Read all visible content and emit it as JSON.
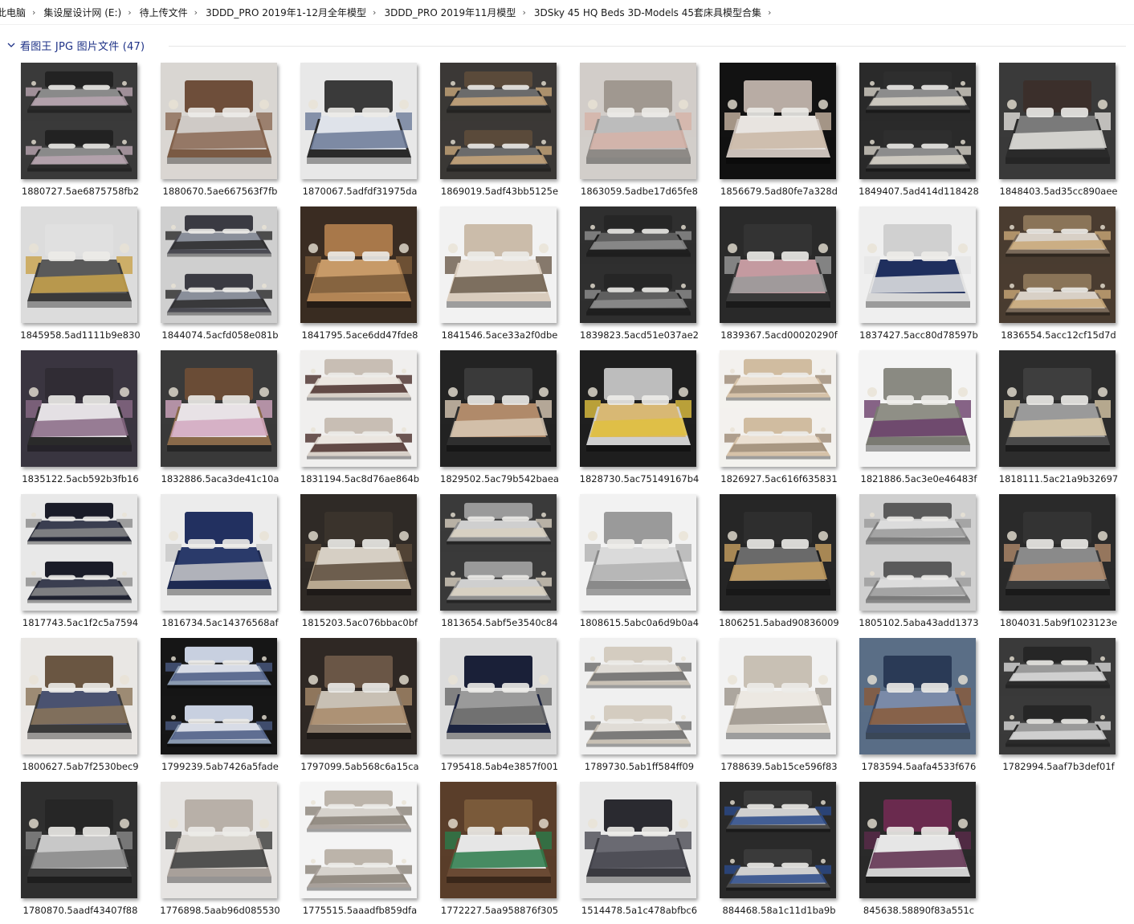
{
  "breadcrumb": [
    "此电脑",
    "集设屋设计网 (E:)",
    "待上传文件",
    "3DDD_PRO 2019年1-12月全年模型",
    "3DDD_PRO 2019年11月模型",
    "3DSky 45 HQ Beds 3D-Models 45套床具模型合集"
  ],
  "group": {
    "title": "看图王 JPG 图片文件 (47)"
  },
  "files": [
    {
      "name": "1880727.5ae6875758fb2",
      "bg": "#3a3a3a",
      "bed": "#2b2b2b",
      "linen": "#8a8a8a",
      "accent": "#b9a5b0",
      "head": "#222222"
    },
    {
      "name": "1880670.5ae667563f7fb",
      "bg": "#d9d6d2",
      "bed": "#7a5a44",
      "linen": "#cfcac6",
      "accent": "#8b6a55",
      "head": "#6e4e3a"
    },
    {
      "name": "1870067.5adfdf31975da",
      "bg": "#e8e8e8",
      "bed": "#2a2a2a",
      "linen": "#dfe3ea",
      "accent": "#6c7a98",
      "head": "#3a3a3a"
    },
    {
      "name": "1869019.5adf43bb5125e",
      "bg": "#3b3836",
      "bed": "#2a2a2a",
      "linen": "#6b6b6b",
      "accent": "#c8a67a",
      "head": "#5a4a3a"
    },
    {
      "name": "1863059.5adbe17d65fe8",
      "bg": "#d2cdc9",
      "bed": "#8e8a86",
      "linen": "#bcbcbc",
      "accent": "#d6b3a8",
      "head": "#a09890"
    },
    {
      "name": "1856679.5ad80fe7a328d",
      "bg": "#121212",
      "bed": "#c9bfb8",
      "linen": "#e8e4e0",
      "accent": "#c9b7a4",
      "head": "#b8aca4"
    },
    {
      "name": "1849407.5ad414d118428",
      "bg": "#2a2a2a",
      "bed": "#3a3a3a",
      "linen": "#8c8c8c",
      "accent": "#d7d2c8",
      "head": "#2e2e2e"
    },
    {
      "name": "1848403.5ad35cc890aee",
      "bg": "#3a3a3a",
      "bed": "#2a2a2a",
      "linen": "#7a7a7a",
      "accent": "#e2e0dc",
      "head": "#3b2f2b"
    },
    {
      "name": "1845958.5ad1111b9e830",
      "bg": "#dcdcdc",
      "bed": "#3a3a3a",
      "linen": "#5a5a5a",
      "accent": "#c9a34b",
      "head": "#e0e0e0"
    },
    {
      "name": "1844074.5acfd058e081b",
      "bg": "#cfcfcf",
      "bed": "#4a4a52",
      "linen": "#8a8f9a",
      "accent": "#2a2a2a",
      "head": "#3a3a42"
    },
    {
      "name": "1841795.5ace6dd47fde8",
      "bg": "#3a2c22",
      "bed": "#b38555",
      "linen": "#c79a68",
      "accent": "#7a5a3a",
      "head": "#a8784a"
    },
    {
      "name": "1841546.5ace33a2f0dbe",
      "bg": "#f2f2f2",
      "bed": "#d9ccbd",
      "linen": "#e8e0d6",
      "accent": "#6a5a4a",
      "head": "#cbbcaa"
    },
    {
      "name": "1839823.5acd51e037ae2",
      "bg": "#2f2f2f",
      "bed": "#1f1f1f",
      "linen": "#5f5f5f",
      "accent": "#8e8e8e",
      "head": "#262626"
    },
    {
      "name": "1839367.5acd00020290f",
      "bg": "#2a2a2a",
      "bed": "#3a3a3a",
      "linen": "#c49aa0",
      "accent": "#9a9a9a",
      "head": "#333333"
    },
    {
      "name": "1837427.5acc80d78597b",
      "bg": "#efefef",
      "bed": "#d8d8d8",
      "linen": "#1f2f5e",
      "accent": "#e6e6e6",
      "head": "#d0d0d0"
    },
    {
      "name": "1836554.5acc12cf15d7d",
      "bg": "#4a3c30",
      "bed": "#7a6a5a",
      "linen": "#d8d0c6",
      "accent": "#c9a878",
      "head": "#8a7458"
    },
    {
      "name": "1835122.5acb592b3fb16",
      "bg": "#3a3540",
      "bed": "#2a2a2a",
      "linen": "#e4e0e4",
      "accent": "#8a6a86",
      "head": "#302c34"
    },
    {
      "name": "1832886.5aca3de41c10a",
      "bg": "#3a3a3a",
      "bed": "#8a6a4a",
      "linen": "#e8e2e6",
      "accent": "#d2a8c0",
      "head": "#6a4c36"
    },
    {
      "name": "1831194.5ac8d76ae864b",
      "bg": "#f0efee",
      "bed": "#d8d0c8",
      "linen": "#ebe6e0",
      "accent": "#4a2e2a",
      "head": "#c8beb4"
    },
    {
      "name": "1829502.5ac79b542baea",
      "bg": "#232323",
      "bed": "#2f2f2f",
      "linen": "#b08a6a",
      "accent": "#d8c8b4",
      "head": "#3a3a3a"
    },
    {
      "name": "1828730.5ac75149167b4",
      "bg": "#1f1f1f",
      "bed": "#cfcfcf",
      "linen": "#d8b874",
      "accent": "#e0c040",
      "head": "#bdbdbd"
    },
    {
      "name": "1826927.5ac616f635831",
      "bg": "#f3f1ee",
      "bed": "#d6c2a8",
      "linen": "#ebe0d2",
      "accent": "#9c8a74",
      "head": "#d0bca0"
    },
    {
      "name": "1821886.5ac3e0e46483f",
      "bg": "#f4f4f4",
      "bed": "#7a7a72",
      "linen": "#8f8f86",
      "accent": "#6a3e6a",
      "head": "#8a8a82"
    },
    {
      "name": "1818111.5ac21a9b32697",
      "bg": "#2c2c2c",
      "bed": "#4a4a4a",
      "linen": "#9a9a9a",
      "accent": "#d8c8a8",
      "head": "#3e3e3e"
    },
    {
      "name": "1817743.5ac1f2c5a7594",
      "bg": "#e8e8e8",
      "bed": "#1f2230",
      "linen": "#3a3e50",
      "accent": "#8a8a8a",
      "head": "#1a1c28"
    },
    {
      "name": "1816734.5ac14376568af",
      "bg": "#ececec",
      "bed": "#1e2a52",
      "linen": "#2a3a6a",
      "accent": "#c8c8c8",
      "head": "#223060"
    },
    {
      "name": "1815203.5ac076bbac0bf",
      "bg": "#2f2a26",
      "bed": "#b8a890",
      "linen": "#d6cfc4",
      "accent": "#5a4a3a",
      "head": "#3a332c"
    },
    {
      "name": "1813654.5abf5e3540c84",
      "bg": "#3a3a3a",
      "bed": "#8e8e8e",
      "linen": "#cfcfcf",
      "accent": "#d8d0c0",
      "head": "#9a9a9a"
    },
    {
      "name": "1808615.5abc0a6d9b0a4",
      "bg": "#f2f2f2",
      "bed": "#8a8a8a",
      "linen": "#dadada",
      "accent": "#b0b0b0",
      "head": "#9a9a9a"
    },
    {
      "name": "1806251.5abad90836009",
      "bg": "#262626",
      "bed": "#1f1f1f",
      "linen": "#6a6a6a",
      "accent": "#c8a060",
      "head": "#2e2e2e"
    },
    {
      "name": "1805102.5aba43add1373",
      "bg": "#cfcfcf",
      "bed": "#7a7a7a",
      "linen": "#dcdcdc",
      "accent": "#9a9a9a",
      "head": "#5a5a5a"
    },
    {
      "name": "1804031.5ab9f1023123e",
      "bg": "#2a2a2a",
      "bed": "#3a3a3a",
      "linen": "#8a8a8a",
      "accent": "#b08a6a",
      "head": "#333333"
    },
    {
      "name": "1800627.5ab7f2530bec9",
      "bg": "#e9e7e4",
      "bed": "#3a3a3a",
      "linen": "#4a5270",
      "accent": "#8a7458",
      "head": "#6a5642"
    },
    {
      "name": "1799239.5ab7426a5fade",
      "bg": "#161616",
      "bed": "#8a9ab0",
      "linen": "#d8dce6",
      "accent": "#4a5a82",
      "head": "#c8d0e0"
    },
    {
      "name": "1797099.5ab568c6a15ca",
      "bg": "#2f2824",
      "bed": "#8a7a6a",
      "linen": "#c8c0b4",
      "accent": "#a88a6a",
      "head": "#6a5646"
    },
    {
      "name": "1795418.5ab4e3857f001",
      "bg": "#dcdcdc",
      "bed": "#1c2440",
      "linen": "#9a9a9a",
      "accent": "#6a6a6a",
      "head": "#1a2038"
    },
    {
      "name": "1789730.5ab1ff584ff09",
      "bg": "#f0f0f0",
      "bed": "#c8c0b4",
      "linen": "#e0dcd6",
      "accent": "#6a6a6a",
      "head": "#d4ccc0"
    },
    {
      "name": "1788639.5ab15ce596f83",
      "bg": "#f2f2f2",
      "bed": "#d6d0c6",
      "linen": "#ece8e2",
      "accent": "#9a9288",
      "head": "#c8c0b4"
    },
    {
      "name": "1783594.5aafa4533f676",
      "bg": "#5a6e86",
      "bed": "#3a4a66",
      "linen": "#7a8aa8",
      "accent": "#8a5a3a",
      "head": "#2a3a56"
    },
    {
      "name": "1782994.5aaf7b3def01f",
      "bg": "#3a3a3a",
      "bed": "#2a2a2a",
      "linen": "#9a9a9a",
      "accent": "#d8d8d8",
      "head": "#262626"
    },
    {
      "name": "1780870.5aadf43407f88",
      "bg": "#2f2f2f",
      "bed": "#3a3a3a",
      "linen": "#c8c8c8",
      "accent": "#8a8a8a",
      "head": "#262626"
    },
    {
      "name": "1776898.5aab96d085530",
      "bg": "#e6e4e2",
      "bed": "#a8a09a",
      "linen": "#d8d4ce",
      "accent": "#3a3a3a",
      "head": "#b8b0a8"
    },
    {
      "name": "1775515.5aaadfb859dfa",
      "bg": "#f4f4f4",
      "bed": "#a8a09a",
      "linen": "#d6d2cc",
      "accent": "#8a8278",
      "head": "#bcb4aa"
    },
    {
      "name": "1772227.5aa958876f305",
      "bg": "#5a3e2a",
      "bed": "#6a4a34",
      "linen": "#e6e6e6",
      "accent": "#2a7a4a",
      "head": "#7a5a3a"
    },
    {
      "name": "1514478.5a1c478abfbc6",
      "bg": "#e8e8e8",
      "bed": "#3a3a40",
      "linen": "#6a6a72",
      "accent": "#4a4a52",
      "head": "#2a2a30"
    },
    {
      "name": "884468.58a1c11d1ba9b",
      "bg": "#2a2a2a",
      "bed": "#4a4a4a",
      "linen": "#cfcfcf",
      "accent": "#2a4a8a",
      "head": "#3a3a3a"
    },
    {
      "name": "845638.58890f83a551c",
      "bg": "#2a2a2a",
      "bed": "#d0d0d0",
      "linen": "#e6e6e6",
      "accent": "#5a2a4a",
      "head": "#6a2a4e"
    }
  ]
}
